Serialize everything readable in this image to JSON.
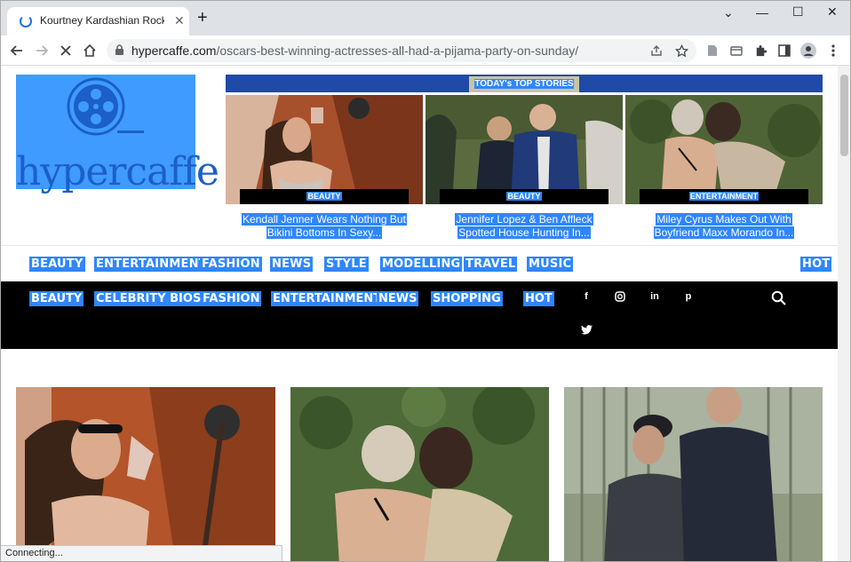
{
  "browser": {
    "tab_title": "Kourtney Kardashian Rocks Over",
    "tab_close": "✕",
    "new_tab": "+",
    "window_controls": {
      "minimize": "—",
      "maximize": "☐",
      "close": "✕",
      "tab_list": "⌄"
    },
    "url_host": "hypercaffe.com",
    "url_path": "/oscars-best-winning-actresses-all-had-a-pijama-party-on-sunday/",
    "icons": [
      "back-icon",
      "forward-icon",
      "stop-reload-icon",
      "home-icon",
      "lock-icon",
      "share-icon",
      "star-icon",
      "page-icon",
      "media-icon",
      "extensions-icon",
      "sidepanel-icon",
      "profile-icon",
      "menu-icon"
    ]
  },
  "site": {
    "logo_text": "hypercaffe",
    "top_stories_label": "TODAY's TOP STORIES",
    "stories": [
      {
        "tag": "BEAUTY",
        "title_line1": "Kendall Jenner Wears Nothing But",
        "title_line2": "Bikini Bottoms In Sexy..."
      },
      {
        "tag": "BEAUTY",
        "title_line1": "Jennifer Lopez & Ben Affleck",
        "title_line2": "Spotted House Hunting In..."
      },
      {
        "tag": "ENTERTAINMENT",
        "title_line1": "Miley Cyrus Makes Out With",
        "title_line2": "Boyfriend Maxx Morando In..."
      }
    ],
    "nav_primary": [
      "BEAUTY",
      "ENTERTAINMENT",
      "FASHION",
      "NEWS",
      "STYLE",
      "MODELLING",
      "TRAVEL",
      "MUSIC",
      "HOT"
    ],
    "nav_secondary": [
      "BEAUTY",
      "CELEBRITY BIOS",
      "FASHION",
      "ENTERTAINMENT",
      "NEWS",
      "SHOPPING",
      "HOT"
    ],
    "social": {
      "facebook": "f",
      "instagram": "◎",
      "linkedin": "in",
      "pinterest": "p",
      "twitter": "🐦"
    },
    "search_icon": "search-icon"
  },
  "status_text": "Connecting...",
  "colors": {
    "selection": "#2f86ff",
    "nav_dark": "#000000",
    "logo_bg": "#3f9bff",
    "ts_bar": "#1f4aa8"
  }
}
